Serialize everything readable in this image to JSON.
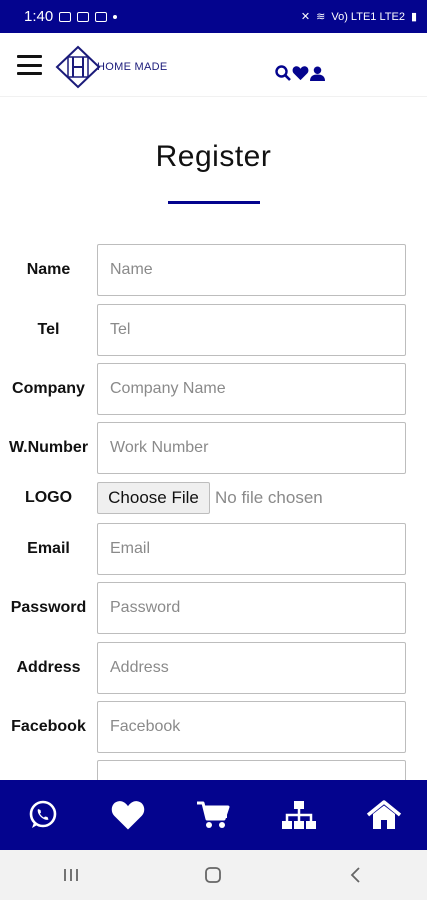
{
  "status_bar": {
    "time": "1:40",
    "network": "Vo) LTE1 LTE2"
  },
  "header": {
    "logo_text": "HOME MADE",
    "icons": [
      "hamburger-icon",
      "search-icon",
      "heart-icon",
      "user-icon"
    ]
  },
  "page": {
    "title": "Register"
  },
  "form": {
    "fields": [
      {
        "label": "Name",
        "placeholder": "Name"
      },
      {
        "label": "Tel",
        "placeholder": "Tel"
      },
      {
        "label": "Company",
        "placeholder": "Company Name"
      },
      {
        "label": "W.Number",
        "placeholder": "Work Number"
      },
      {
        "label": "Email",
        "placeholder": "Email"
      },
      {
        "label": "Password",
        "placeholder": "Password"
      },
      {
        "label": "Address",
        "placeholder": "Address"
      },
      {
        "label": "Facebook",
        "placeholder": "Facebook"
      }
    ],
    "logo": {
      "label": "LOGO",
      "button": "Choose File",
      "status": "No file chosen"
    }
  },
  "bottom_nav": {
    "items": [
      "whatsapp-icon",
      "heart-icon",
      "cart-icon",
      "sitemap-icon",
      "home-icon"
    ]
  },
  "colors": {
    "brand": "#04048e",
    "input_border": "#bdbdbd",
    "placeholder": "#8a8a8a"
  }
}
